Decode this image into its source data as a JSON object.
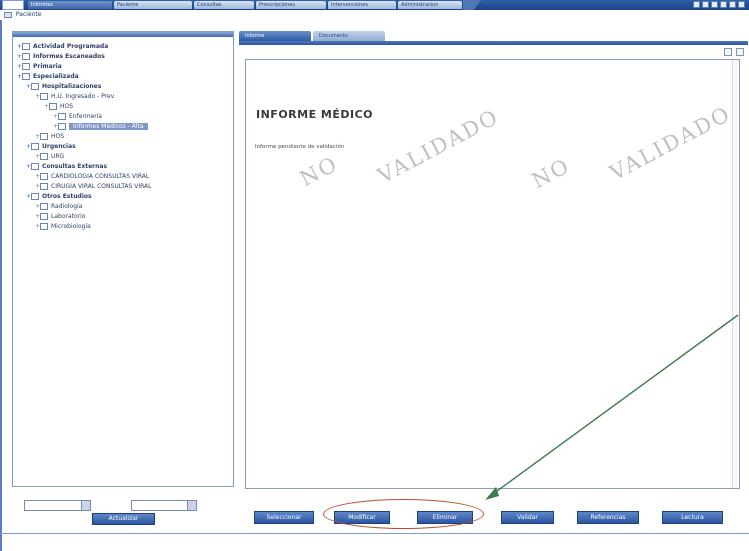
{
  "topbar": {
    "tabs": [
      {
        "label": "Informes",
        "active": true
      },
      {
        "label": "Paciente",
        "active": false
      },
      {
        "label": "Consultas",
        "active": false
      },
      {
        "label": "Prescripciones",
        "active": false
      },
      {
        "label": "Intervenciones",
        "active": false
      },
      {
        "label": "Administracion",
        "active": false
      }
    ]
  },
  "paciente": {
    "label": "Paciente"
  },
  "tree": {
    "items": [
      {
        "label": "Actividad Programada",
        "level": 1,
        "bold": true
      },
      {
        "label": "Informes Escaneados",
        "level": 1,
        "bold": true
      },
      {
        "label": "Primaria",
        "level": 1,
        "bold": true
      },
      {
        "label": "Especializada",
        "level": 1,
        "bold": true
      },
      {
        "label": "Hospitalizaciones",
        "level": 2,
        "bold": true
      },
      {
        "label": "H.U. Ingresado - Prev",
        "level": 3,
        "bold": false
      },
      {
        "label": "HOS",
        "level": 4,
        "bold": false
      },
      {
        "label": "Enfermería",
        "level": 5,
        "bold": false
      },
      {
        "label": "Informes Médicos - Alta",
        "level": 5,
        "bold": false,
        "selected": true
      },
      {
        "label": "HOS",
        "level": 3,
        "bold": false
      },
      {
        "label": "Urgencias",
        "level": 2,
        "bold": true
      },
      {
        "label": "URG",
        "level": 3,
        "bold": false
      },
      {
        "label": "Consultas Externas",
        "level": 2,
        "bold": true
      },
      {
        "label": "CARDIOLOGIA CONSULTAS VIRAL",
        "level": 3,
        "bold": false
      },
      {
        "label": "CIRUGIA VIRAL CONSULTAS VIRAL",
        "level": 3,
        "bold": false
      },
      {
        "label": "Otros Estudios",
        "level": 2,
        "bold": true
      },
      {
        "label": "Radiología",
        "level": 3,
        "bold": false
      },
      {
        "label": "Laboratorio",
        "level": 3,
        "bold": false
      },
      {
        "label": "Microbiología",
        "level": 3,
        "bold": false
      }
    ]
  },
  "left_controls": {
    "actualizar": "Actualizar"
  },
  "right": {
    "tabs": [
      "Informe",
      "Documento"
    ],
    "title": "INFORME MÉDICO",
    "pending_text": "Informe pendiente de validación",
    "watermarks": [
      "NO",
      "VALIDADO",
      "NO",
      "VALIDADO"
    ]
  },
  "buttons": {
    "seleccionar": "Seleccionar",
    "modificar": "Modificar",
    "eliminar": "Eliminar",
    "validar": "Validar",
    "referencias": "Referencias",
    "lectura": "Lectura"
  },
  "colors": {
    "accent": "#2b56a0",
    "annotation": "#b8502f",
    "arrow": "#3f7a4f"
  }
}
